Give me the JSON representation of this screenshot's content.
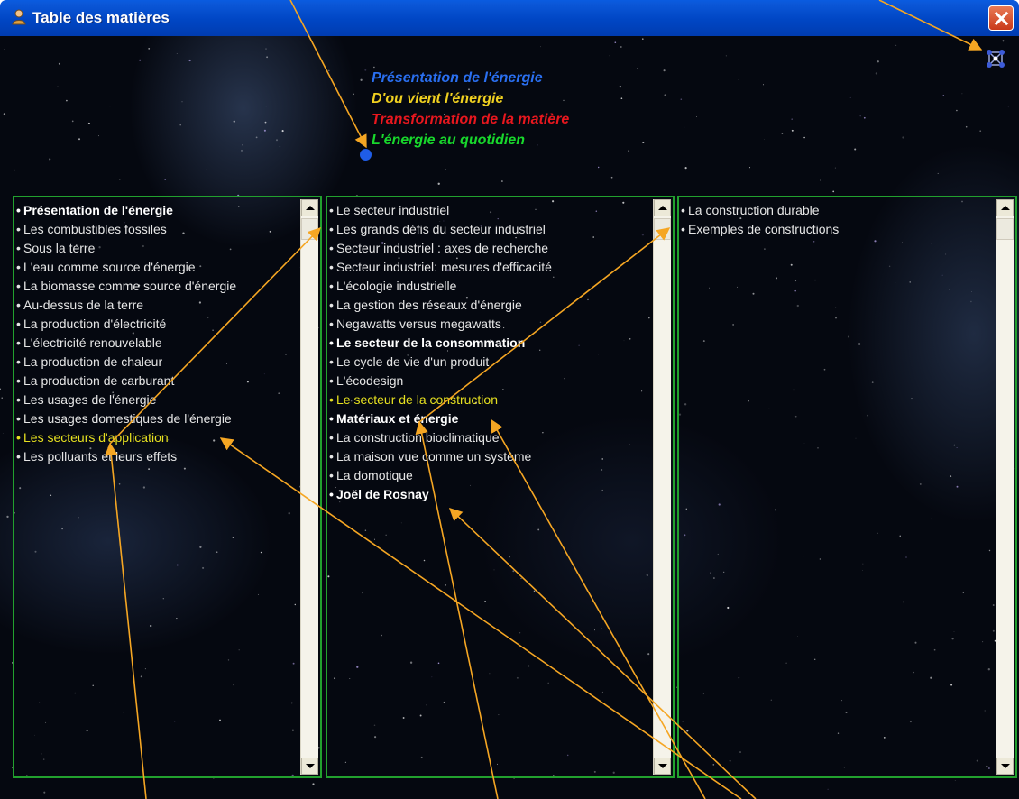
{
  "window": {
    "title": "Table des matières",
    "title_icon": "person-icon"
  },
  "menu": {
    "items": [
      {
        "label": "Présentation de l'énergie",
        "color": "#2a6ff0"
      },
      {
        "label": "D'ou vient l'énergie",
        "color": "#f0d020"
      },
      {
        "label": "Transformation de la matière",
        "color": "#e8171e"
      },
      {
        "label": "L'énergie au quotidien",
        "color": "#18d82c",
        "selected": true
      }
    ]
  },
  "panels": [
    {
      "items": [
        {
          "label": "Présentation de l'énergie",
          "bold": true
        },
        {
          "label": "Les combustibles fossiles"
        },
        {
          "label": "Sous la terre"
        },
        {
          "label": "L'eau comme source d'énergie"
        },
        {
          "label": "La biomasse comme source d'énergie"
        },
        {
          "label": "Au-dessus de la terre"
        },
        {
          "label": "La production d'électricité"
        },
        {
          "label": "L'électricité renouvelable"
        },
        {
          "label": "La production de chaleur"
        },
        {
          "label": "La production de carburant"
        },
        {
          "label": "Les usages de l'énergie"
        },
        {
          "label": "Les usages domestiques de l'énergie"
        },
        {
          "label": "Les secteurs d'application",
          "highlighted": true
        },
        {
          "label": "Les polluants et leurs effets"
        }
      ]
    },
    {
      "items": [
        {
          "label": "Le secteur industriel"
        },
        {
          "label": "Les grands défis du secteur industriel"
        },
        {
          "label": "Secteur industriel : axes de recherche"
        },
        {
          "label": "Secteur industriel: mesures d'efficacité"
        },
        {
          "label": "L'écologie industrielle"
        },
        {
          "label": "La gestion des réseaux d'énergie"
        },
        {
          "label": "Negawatts versus megawatts"
        },
        {
          "label": "Le secteur de la consommation",
          "bold": true
        },
        {
          "label": "Le cycle de vie d'un produit"
        },
        {
          "label": "L'écodesign"
        },
        {
          "label": "Le secteur de la construction",
          "highlighted": true
        },
        {
          "label": "Matériaux et énergie",
          "bold": true
        },
        {
          "label": "La construction bioclimatique"
        },
        {
          "label": "La maison vue comme un système"
        },
        {
          "label": "La domotique"
        },
        {
          "label": "Joël de Rosnay",
          "bold": true
        }
      ]
    },
    {
      "items": [
        {
          "label": "La construction durable"
        },
        {
          "label": "Exemples de constructions"
        }
      ]
    }
  ],
  "colors": {
    "highlight": "#e6e020",
    "panel_border": "#22a02e",
    "annotation_arrow": "#f5a623",
    "selection_dot": "#1f5de8"
  },
  "icons": {
    "network": "network-icon",
    "close": "close-icon",
    "scroll_up": "arrow-up-icon",
    "scroll_down": "arrow-down-icon"
  }
}
